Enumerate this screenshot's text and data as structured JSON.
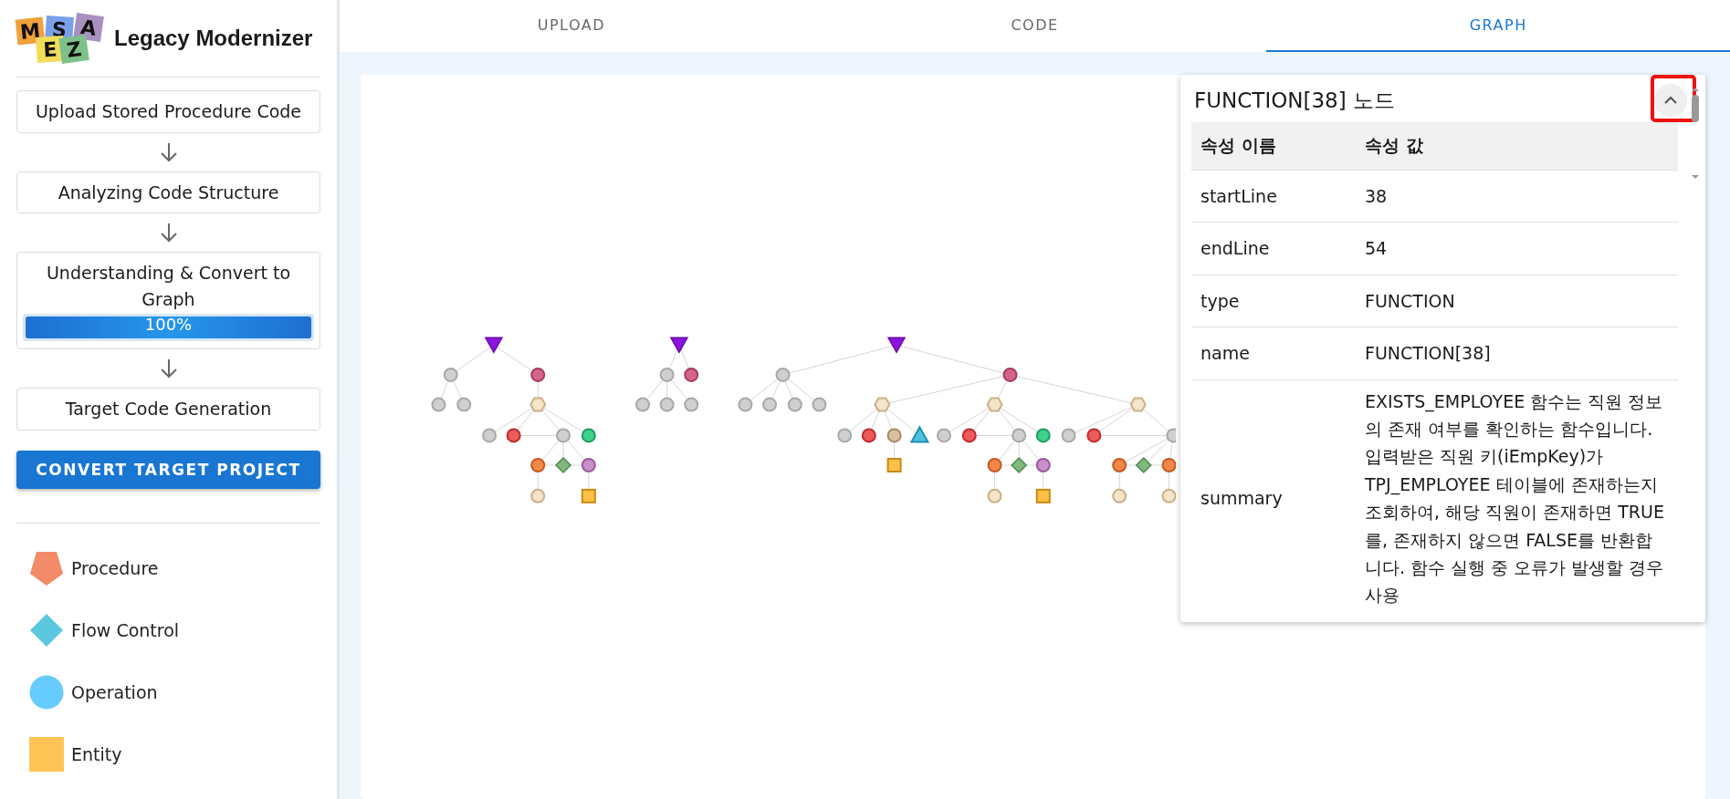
{
  "app": {
    "title": "Legacy Modernizer",
    "logo_letters": [
      "M",
      "S",
      "A",
      "E",
      "Z"
    ]
  },
  "steps": [
    {
      "label": "Upload Stored Procedure Code"
    },
    {
      "label": "Analyzing Code Structure"
    },
    {
      "label": "Understanding & Convert to Graph",
      "progress": {
        "level": 1,
        "text": "100%"
      }
    },
    {
      "label": "Target Code Generation"
    }
  ],
  "convert_button": "CONVERT TARGET PROJECT",
  "legend": [
    {
      "label": "Procedure",
      "kind": "pentagon",
      "color": "#f28b67"
    },
    {
      "label": "Flow Control",
      "kind": "diamond",
      "color": "#5bc8e0"
    },
    {
      "label": "Operation",
      "kind": "circle",
      "color": "#66ccff"
    },
    {
      "label": "Entity",
      "kind": "square",
      "color": "#ffc456"
    }
  ],
  "tabs": [
    {
      "label": "UPLOAD",
      "selected": false
    },
    {
      "label": "CODE",
      "selected": false
    },
    {
      "label": "GRAPH",
      "selected": true
    }
  ],
  "node_panel": {
    "title": "FUNCTION[38] 노드",
    "columns": [
      "속성 이름",
      "속성 값"
    ],
    "rows": [
      {
        "name": "startLine",
        "value": "38"
      },
      {
        "name": "endLine",
        "value": "54"
      },
      {
        "name": "type",
        "value": "FUNCTION"
      },
      {
        "name": "name",
        "value": "FUNCTION[38]"
      },
      {
        "name": "summary",
        "value": "EXISTS_EMPLOYEE 함수는 직원 정보의 존재 여부를 확인하는 함수입니다. 입력받은 직원 키(iEmpKey)가 TPJ_EMPLOYEE 테이블에 존재하는지 조회하여, 해당 직원이 존재하면 TRUE를, 존재하지 않으면 FALSE를 반환합니다. 함수 실행 중 오류가 발생할 경우 사용"
      }
    ]
  }
}
